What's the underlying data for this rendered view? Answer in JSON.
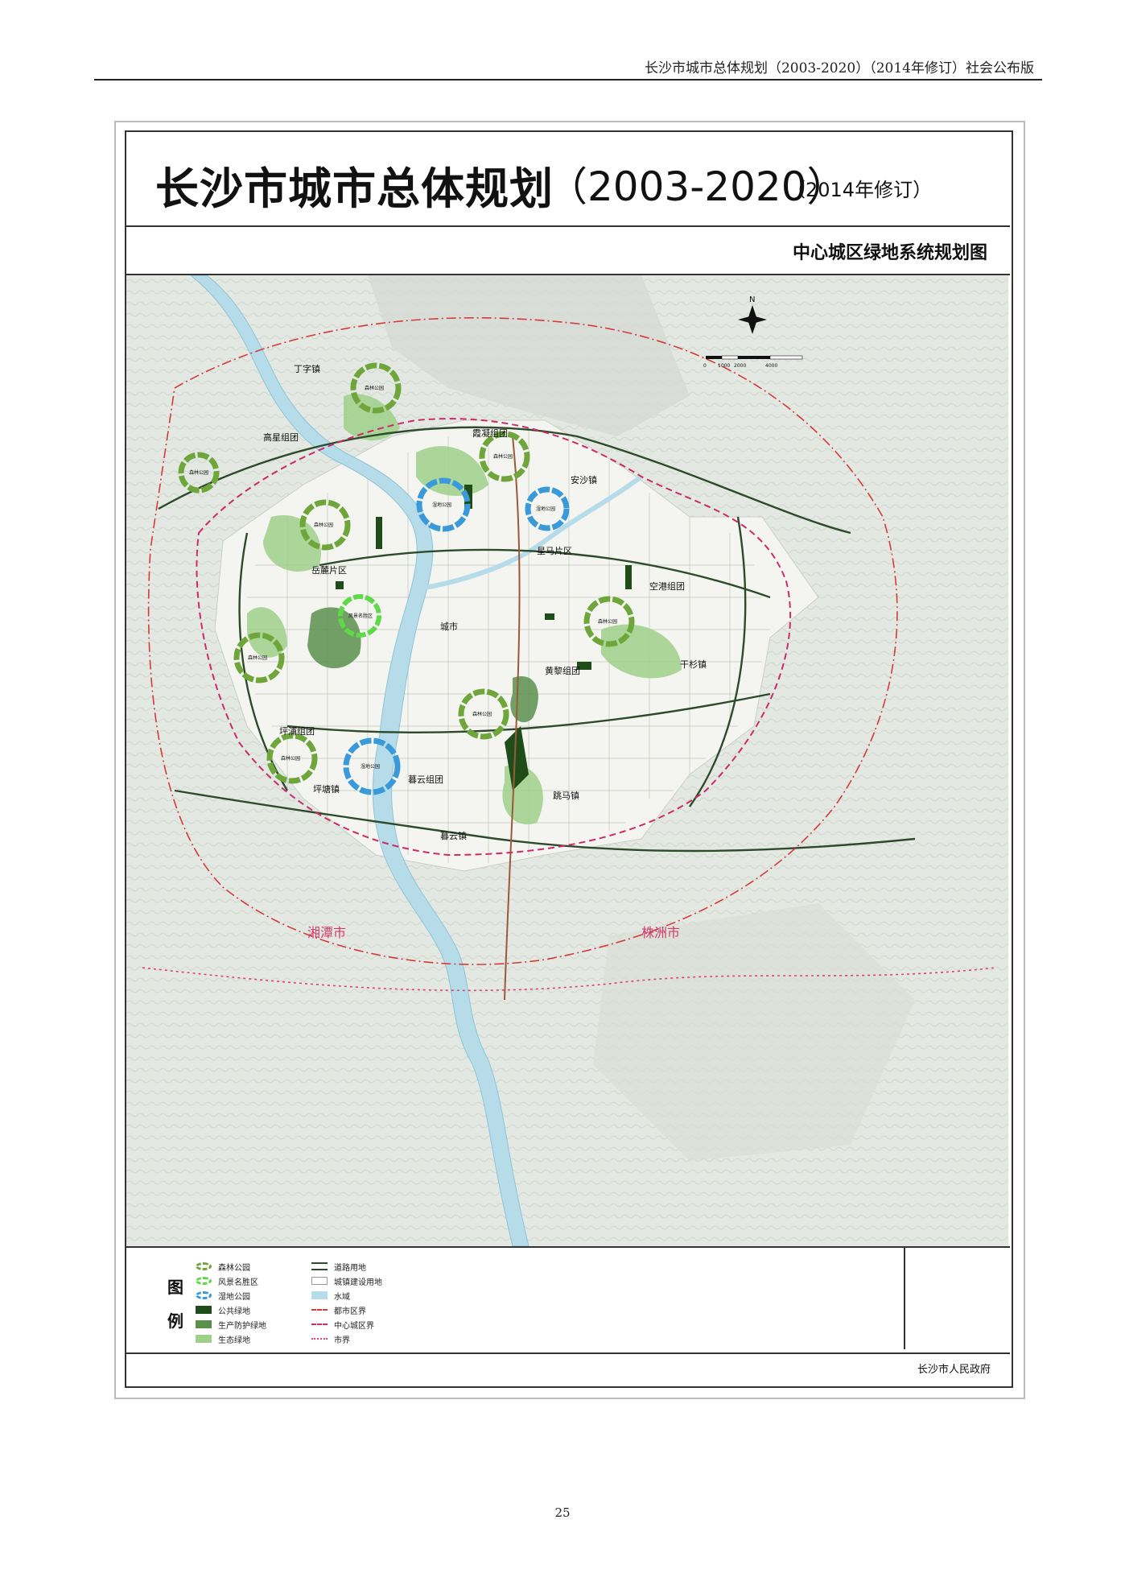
{
  "page_header": "长沙市城市总体规划（2003-2020）（2014年修订）社会公布版",
  "title": {
    "main": "长沙市城市总体规划",
    "years": "（2003-2020）",
    "revision": "（2014年修订）"
  },
  "subtitle": "中心城区绿地系统规划图",
  "map": {
    "north_label": "N",
    "scale_labels": [
      "0",
      "1000",
      "2000",
      "4000"
    ],
    "place_labels": {
      "dingzi": "丁字镇",
      "gaoxing": "高星组团",
      "anshagroup": "安沙镇",
      "yuelu": "岳麓片区",
      "chengshi": "城市",
      "konggang": "空港组团",
      "ganshan": "干杉镇",
      "huangli": "黄黎组团",
      "pingpu": "坪浦组团",
      "pingtang": "坪塘镇",
      "muyun_group": "暮云组团",
      "muyun": "暮云镇",
      "yuema": "跳马镇",
      "xiangtan": "湘潭市",
      "zhuzhou": "株洲市",
      "xingma": "星马片区",
      "dahu": "霞凝组团"
    },
    "parks": {
      "p1": "森林公园",
      "p2": "森林公园",
      "p3": "森林公园",
      "p4": "森林公园",
      "p5": "森林公园",
      "p6": "森林公园",
      "p7": "森林公园",
      "p8": "森林公园",
      "w1": "湿地公园",
      "w2": "湿地公园",
      "w3": "湿地公园",
      "s1": "风景名胜区"
    },
    "colors": {
      "forest_park_ring": "#6fa63c",
      "scenic_ring": "#5fd84a",
      "wetland_ring": "#3a9ad9",
      "public_green": "#1f4d1a",
      "protective_green": "#5a8f4c",
      "ecological_green": "#9fd08a",
      "water": "#b6dcea",
      "road": "#2d4a2a",
      "city_boundary": "#e0407a",
      "district_boundary": "#d43a3a",
      "urban_boundary": "#cc2a6a"
    }
  },
  "legend": {
    "title": "图例",
    "items": [
      {
        "label": "森林公园",
        "kind": "forest_ring"
      },
      {
        "label": "风景名胜区",
        "kind": "scenic_ring"
      },
      {
        "label": "湿地公园",
        "kind": "wetland_ring"
      },
      {
        "label": "公共绿地",
        "kind": "public_green"
      },
      {
        "label": "生产防护绿地",
        "kind": "protective_green"
      },
      {
        "label": "生态绿地",
        "kind": "ecological_green"
      },
      {
        "label": "道路用地",
        "kind": "road"
      },
      {
        "label": "城镇建设用地",
        "kind": "urban"
      },
      {
        "label": "水域",
        "kind": "water"
      },
      {
        "label": "都市区界",
        "kind": "district_boundary"
      },
      {
        "label": "中心城区界",
        "kind": "urban_boundary"
      },
      {
        "label": "市界",
        "kind": "city_boundary"
      }
    ]
  },
  "footer": "长沙市人民政府",
  "page_number": "25"
}
